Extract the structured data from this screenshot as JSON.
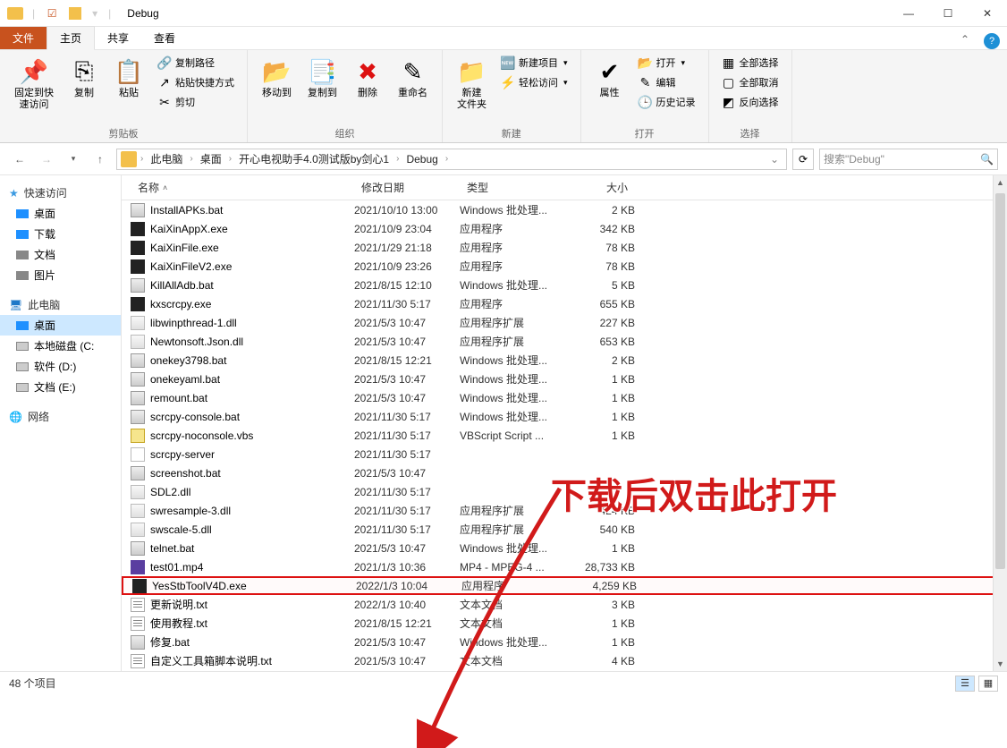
{
  "window": {
    "title": "Debug"
  },
  "tabs": {
    "file": "文件",
    "home": "主页",
    "share": "共享",
    "view": "查看"
  },
  "ribbon": {
    "pin": "固定到快\n速访问",
    "copy": "复制",
    "paste": "粘贴",
    "copypath": "复制路径",
    "pasteshortcut": "粘贴快捷方式",
    "cut": "剪切",
    "group_clipboard": "剪贴板",
    "moveto": "移动到",
    "copyto": "复制到",
    "delete": "删除",
    "rename": "重命名",
    "group_organize": "组织",
    "newfolder": "新建\n文件夹",
    "newitem": "新建项目",
    "easyaccess": "轻松访问",
    "group_new": "新建",
    "properties": "属性",
    "open": "打开",
    "edit": "编辑",
    "history": "历史记录",
    "group_open": "打开",
    "selectall": "全部选择",
    "selectnone": "全部取消",
    "invertsel": "反向选择",
    "group_select": "选择"
  },
  "breadcrumbs": [
    "此电脑",
    "桌面",
    "开心电视助手4.0测试版by剑心1",
    "Debug"
  ],
  "search": {
    "placeholder": "搜索\"Debug\""
  },
  "sidebar": {
    "quickaccess": "快速访问",
    "desktop": "桌面",
    "downloads": "下载",
    "documents": "文档",
    "pictures": "图片",
    "thispc": "此电脑",
    "desktop2": "桌面",
    "localdisk": "本地磁盘 (C:",
    "software": "软件 (D:)",
    "docs2": "文档 (E:)",
    "network": "网络"
  },
  "columns": {
    "name": "名称",
    "date": "修改日期",
    "type": "类型",
    "size": "大小"
  },
  "files": [
    {
      "name": "InstallAPKs.bat",
      "date": "2021/10/10 13:00",
      "type": "Windows 批处理...",
      "size": "2 KB",
      "icon": "bat"
    },
    {
      "name": "KaiXinAppX.exe",
      "date": "2021/10/9 23:04",
      "type": "应用程序",
      "size": "342 KB",
      "icon": "exe"
    },
    {
      "name": "KaiXinFile.exe",
      "date": "2021/1/29 21:18",
      "type": "应用程序",
      "size": "78 KB",
      "icon": "exe"
    },
    {
      "name": "KaiXinFileV2.exe",
      "date": "2021/10/9 23:26",
      "type": "应用程序",
      "size": "78 KB",
      "icon": "exe"
    },
    {
      "name": "KillAllAdb.bat",
      "date": "2021/8/15 12:10",
      "type": "Windows 批处理...",
      "size": "5 KB",
      "icon": "bat"
    },
    {
      "name": "kxscrcpy.exe",
      "date": "2021/11/30 5:17",
      "type": "应用程序",
      "size": "655 KB",
      "icon": "exe"
    },
    {
      "name": "libwinpthread-1.dll",
      "date": "2021/5/3 10:47",
      "type": "应用程序扩展",
      "size": "227 KB",
      "icon": "dll"
    },
    {
      "name": "Newtonsoft.Json.dll",
      "date": "2021/5/3 10:47",
      "type": "应用程序扩展",
      "size": "653 KB",
      "icon": "dll"
    },
    {
      "name": "onekey3798.bat",
      "date": "2021/8/15 12:21",
      "type": "Windows 批处理...",
      "size": "2 KB",
      "icon": "bat"
    },
    {
      "name": "onekeyaml.bat",
      "date": "2021/5/3 10:47",
      "type": "Windows 批处理...",
      "size": "1 KB",
      "icon": "bat"
    },
    {
      "name": "remount.bat",
      "date": "2021/5/3 10:47",
      "type": "Windows 批处理...",
      "size": "1 KB",
      "icon": "bat"
    },
    {
      "name": "scrcpy-console.bat",
      "date": "2021/11/30 5:17",
      "type": "Windows 批处理...",
      "size": "1 KB",
      "icon": "bat"
    },
    {
      "name": "scrcpy-noconsole.vbs",
      "date": "2021/11/30 5:17",
      "type": "VBScript Script ...",
      "size": "1 KB",
      "icon": "vbs"
    },
    {
      "name": "scrcpy-server",
      "date": "2021/11/30 5:17",
      "type": "",
      "size": "",
      "icon": "file"
    },
    {
      "name": "screenshot.bat",
      "date": "2021/5/3 10:47",
      "type": "",
      "size": "",
      "icon": "bat"
    },
    {
      "name": "SDL2.dll",
      "date": "2021/11/30 5:17",
      "type": "",
      "size": "",
      "icon": "dll"
    },
    {
      "name": "swresample-3.dll",
      "date": "2021/11/30 5:17",
      "type": "应用程序扩展",
      "size": "424 KB",
      "icon": "dll"
    },
    {
      "name": "swscale-5.dll",
      "date": "2021/11/30 5:17",
      "type": "应用程序扩展",
      "size": "540 KB",
      "icon": "dll"
    },
    {
      "name": "telnet.bat",
      "date": "2021/5/3 10:47",
      "type": "Windows 批处理...",
      "size": "1 KB",
      "icon": "bat"
    },
    {
      "name": "test01.mp4",
      "date": "2021/1/3 10:36",
      "type": "MP4 - MPEG-4 ...",
      "size": "28,733 KB",
      "icon": "mp4"
    },
    {
      "name": "YesStbToolV4D.exe",
      "date": "2022/1/3 10:04",
      "type": "应用程序",
      "size": "4,259 KB",
      "icon": "exe",
      "highlight": true
    },
    {
      "name": "更新说明.txt",
      "date": "2022/1/3 10:40",
      "type": "文本文档",
      "size": "3 KB",
      "icon": "txt"
    },
    {
      "name": "使用教程.txt",
      "date": "2021/8/15 12:21",
      "type": "文本文档",
      "size": "1 KB",
      "icon": "txt"
    },
    {
      "name": "修复.bat",
      "date": "2021/5/3 10:47",
      "type": "Windows 批处理...",
      "size": "1 KB",
      "icon": "bat"
    },
    {
      "name": "自定义工具箱脚本说明.txt",
      "date": "2021/5/3 10:47",
      "type": "文本文档",
      "size": "4 KB",
      "icon": "txt"
    }
  ],
  "status": {
    "count": "48 个项目"
  },
  "annotation": {
    "text": "下载后双击此打开"
  }
}
